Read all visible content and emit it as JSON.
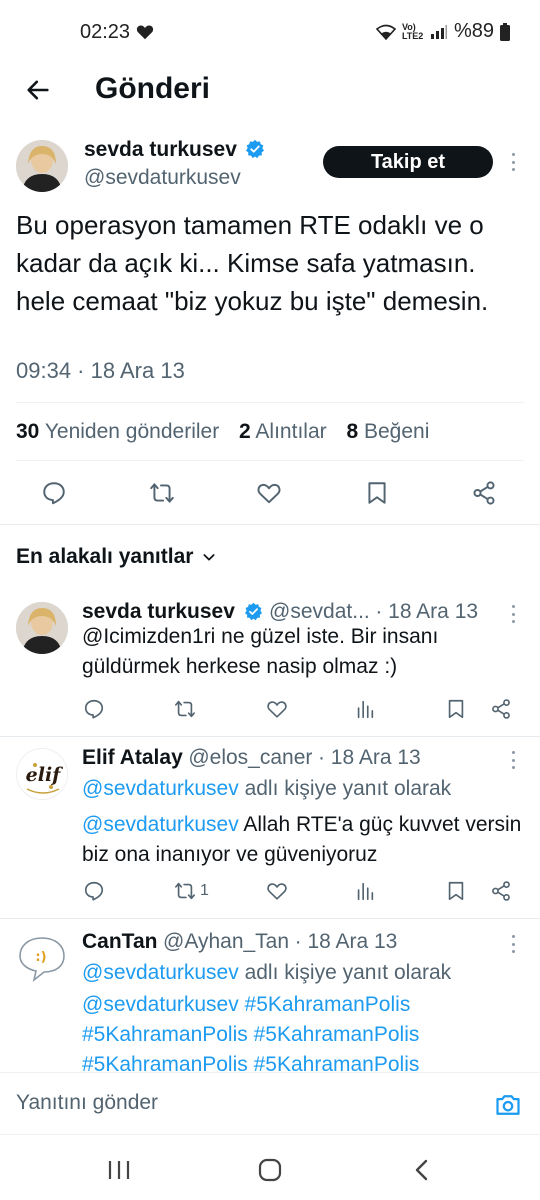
{
  "status_bar": {
    "time": "02:23",
    "network": "Vo) LTE2",
    "battery": "%89",
    "icons": [
      "heart-icon",
      "wifi-icon",
      "signal-icon",
      "battery-icon"
    ]
  },
  "header": {
    "title": "Gönderi",
    "back_icon": "arrow-left-icon"
  },
  "main_post": {
    "author_name": "sevda turkusev",
    "author_handle": "@sevdaturkusev",
    "follow_label": "Takip et",
    "text": "Bu operasyon tamamen RTE odaklı ve o kadar da açık ki... Kimse safa yatmasın. hele cemaat \"biz yokuz bu işte\" demesin.",
    "time": "09:34",
    "date": "18 Ara 13",
    "stats": {
      "reposts_count": "30",
      "reposts_label": "Yeniden gönderiler",
      "quotes_count": "2",
      "quotes_label": "Alıntılar",
      "likes_count": "8",
      "likes_label": "Beğeni"
    },
    "actions": [
      "reply-icon",
      "repost-icon",
      "like-icon",
      "bookmark-icon",
      "share-icon"
    ]
  },
  "sort": {
    "label": "En alakalı yanıtlar"
  },
  "replies": [
    {
      "name": "sevda turkusev",
      "handle": "@sevdat...",
      "date": "18 Ara 13",
      "verified": true,
      "text": "@Icimizden1ri ne güzel iste. Bir insanı güldürmek herkese nasip olmaz :)",
      "repost_count": ""
    },
    {
      "name": "Elif Atalay",
      "handle": "@elos_caner",
      "date": "18 Ara 13",
      "verified": false,
      "replying_to_handle": "@sevdaturkusev",
      "replying_to_suffix": "adlı kişiye yanıt olarak",
      "mention": "@sevdaturkusev",
      "text": "Allah RTE'a güç kuvvet versin biz ona inanıyor ve güveniyoruz",
      "repost_count": "1",
      "avatar_text": "elif"
    },
    {
      "name": "CanTan",
      "handle": "@Ayhan_Tan",
      "date": "18 Ara 13",
      "verified": false,
      "replying_to_handle": "@sevdaturkusev",
      "replying_to_suffix": "adlı kişiye yanıt olarak",
      "hashtags_line1": "@sevdaturkusev #5KahramanPolis",
      "hashtags_line2": "#5KahramanPolis #5KahramanPolis",
      "hashtags_line3": "#5KahramanPolis #5KahramanPolis",
      "avatar_text": ":)"
    }
  ],
  "compose": {
    "placeholder": "Yanıtını gönder",
    "camera_icon": "camera-icon"
  },
  "nav": [
    "recent-apps-icon",
    "home-icon",
    "back-icon"
  ],
  "colors": {
    "accent": "#1d9bf0",
    "text": "#0f1419",
    "muted": "#536471",
    "follow_bg": "#0f1419"
  }
}
